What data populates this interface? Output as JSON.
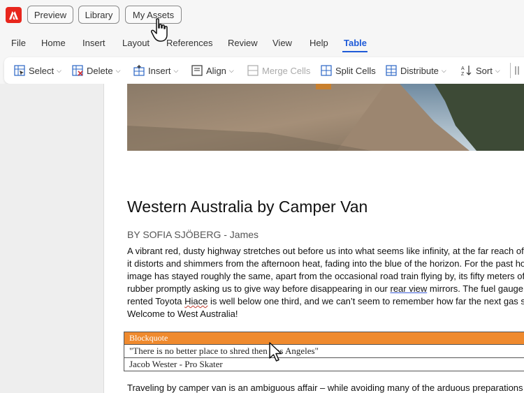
{
  "header": {
    "app_icon": "adobe-logo-icon",
    "buttons": [
      "Preview",
      "Library",
      "My Assets"
    ]
  },
  "menu": {
    "items": [
      "File",
      "Home",
      "Insert",
      "Layout",
      "References",
      "Review",
      "View",
      "Help",
      "Table"
    ],
    "active": "Table"
  },
  "toolbar": {
    "select": "Select",
    "delete": "Delete",
    "insert": "Insert",
    "align": "Align",
    "merge_cells": "Merge Cells",
    "split_cells": "Split Cells",
    "distribute": "Distribute",
    "sort": "Sort"
  },
  "document": {
    "title": "Western Australia by Camper Van",
    "byline": "BY SOFIA SJÖBERG - James",
    "paragraph": {
      "l1": "A vibrant red, dusty highway stretches out before us into what seems like infinity, at the far reach of",
      "l2": "it distorts and shimmers from the afternoon heat, fading into the blue of the horizon. For the past ho",
      "l3": "image has stayed roughly the same, apart from the occasional road train flying by, its fifty meters of",
      "l4a": "rubber promptly asking us to give way before disappearing in our ",
      "l4b": "rear view",
      "l4c": " mirrors. The fuel gauge",
      "l5a": "rented Toyota ",
      "l5b": "Hiace",
      "l5c": " is well below one third, and we can’t seem to remember how far the next gas s",
      "l6": "Welcome to West Australia!"
    },
    "blockquote": {
      "header": "Blockquote",
      "quote": "\"There is no better place to shred then Los Angeles\"",
      "author": "Jacob Wester - Pro Skater"
    },
    "next_paragraph": "Traveling by camper van is an ambiguous affair – while avoiding many of the arduous preparations"
  },
  "colors": {
    "accent": "#1f5bd8",
    "adobe_red": "#e8261d",
    "blockquote_header": "#ef8a2e"
  }
}
